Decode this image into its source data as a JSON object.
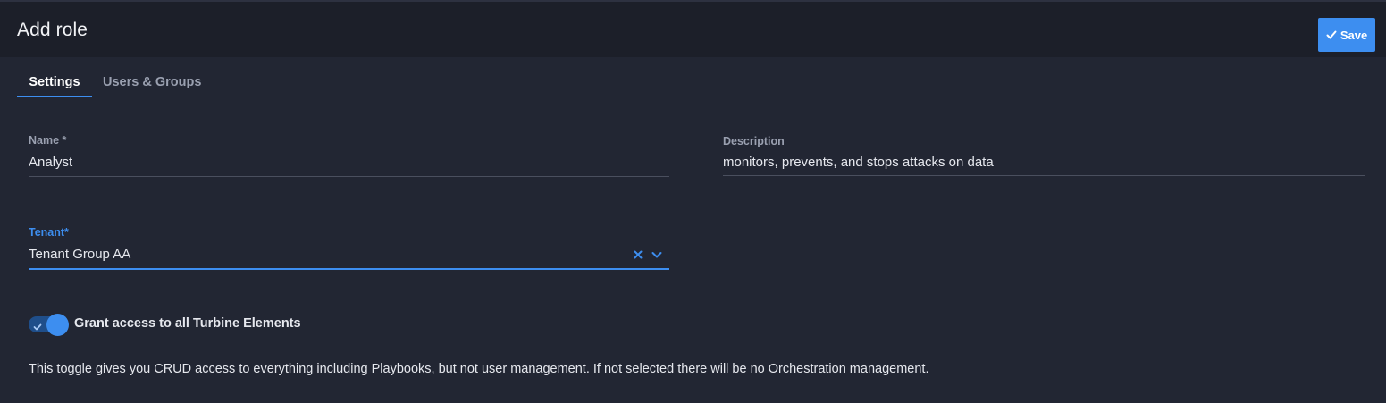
{
  "header": {
    "title": "Add role",
    "save_label": "Save"
  },
  "tabs": [
    {
      "label": "Settings",
      "active": true
    },
    {
      "label": "Users & Groups",
      "active": false
    }
  ],
  "form": {
    "name": {
      "label": "Name *",
      "value": "Analyst"
    },
    "description": {
      "label": "Description",
      "value": "monitors, prevents, and stops attacks on data"
    },
    "tenant": {
      "label": "Tenant*",
      "value": "Tenant Group AA"
    },
    "grant_access": {
      "label": "Grant access to all Turbine Elements",
      "enabled": true,
      "help": "This toggle gives you CRUD access to everything including Playbooks, but not user management. If not selected there will be no Orchestration management."
    }
  },
  "icons": {
    "save": "check-icon",
    "clear": "close-icon",
    "dropdown": "chevron-down-icon",
    "toggle": "check-icon"
  },
  "colors": {
    "accent": "#3d8ef0",
    "background": "#222633",
    "header_background": "#1c1f29",
    "toggle_track": "#1f4e8a"
  }
}
